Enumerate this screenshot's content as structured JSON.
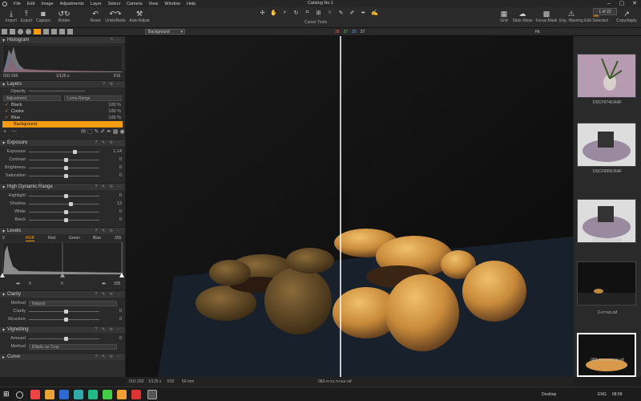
{
  "titlebar": {
    "menus": [
      "File",
      "Edit",
      "Image",
      "Adjustments",
      "Layer",
      "Select",
      "Camera",
      "View",
      "Window",
      "Help"
    ],
    "title": "Catalog No.1"
  },
  "toolbar": {
    "left": [
      "Import",
      "Export",
      "Capture",
      "Rotate",
      "Reset",
      "Undo/Redo",
      "Auto Adjust"
    ],
    "cursor_tools_label": "Cursor Tools",
    "right": [
      "Grid",
      "Slide Show",
      "Focus Mask",
      "Exp. Warning",
      "Edit Selected",
      "Copy/Apply"
    ],
    "page": "1 of 22"
  },
  "subbar": {
    "view": "Background",
    "numbers": [
      "38",
      "27",
      "25",
      "27"
    ],
    "fit": "Fit"
  },
  "histogram": {
    "title": "Histogram",
    "iso": "ISO 200",
    "shutter": "1/125 s",
    "aperture": "f/16"
  },
  "layers": {
    "title": "Layers",
    "opacity": "Opacity",
    "adjustment": "Adjustment",
    "luma": "Luma Range",
    "items": [
      {
        "name": "Black",
        "pct": "100 %"
      },
      {
        "name": "Cooks",
        "pct": "100 %"
      },
      {
        "name": "Blue",
        "pct": "100 %"
      },
      {
        "name": "Background",
        "pct": ""
      }
    ]
  },
  "exposure": {
    "title": "Exposure",
    "rows": [
      {
        "label": "Exposure",
        "value": "1.14",
        "pos": 0.62
      },
      {
        "label": "Contrast",
        "value": "0",
        "pos": 0.5
      },
      {
        "label": "Brightness",
        "value": "0",
        "pos": 0.5
      },
      {
        "label": "Saturation",
        "value": "0",
        "pos": 0.5
      }
    ]
  },
  "hdr": {
    "title": "High Dynamic Range",
    "rows": [
      {
        "label": "Highlight",
        "value": "0",
        "pos": 0.5
      },
      {
        "label": "Shadow",
        "value": "13",
        "pos": 0.57
      },
      {
        "label": "White",
        "value": "0",
        "pos": 0.5
      },
      {
        "label": "Black",
        "value": "0",
        "pos": 0.5
      }
    ]
  },
  "levels": {
    "title": "Levels",
    "left_val": "0",
    "right_val": "255",
    "channels": [
      "RGB",
      "Red",
      "Green",
      "Blue"
    ],
    "bottom_left": "0",
    "bottom_mid": "0",
    "bottom_right": "255"
  },
  "clarity": {
    "title": "Clarity",
    "method_label": "Method",
    "method": "Natural",
    "rows": [
      {
        "label": "Clarity",
        "value": "0",
        "pos": 0.5
      },
      {
        "label": "Structure",
        "value": "0",
        "pos": 0.5
      }
    ]
  },
  "vignetting": {
    "title": "Vignetting",
    "amount_label": "Amount",
    "amount": "0",
    "method_label": "Method",
    "method": "Elliptic on Crop"
  },
  "curve": {
    "title": "Curve"
  },
  "filmstrip": [
    {
      "label": "DSCF9740.RAF"
    },
    {
      "label": "DSCF9993.RAF"
    },
    {
      "label": "DSCF9994.RAF"
    },
    {
      "label": "2-מגירה.raf"
    },
    {
      "label": "083-עוגיות בבית.raf"
    }
  ],
  "status": {
    "iso": "ISO 200",
    "shutter": "1/125 s",
    "aperture": "f/16",
    "focal": "50 mm",
    "filename": "083-עוגיות בבית.raf"
  },
  "taskbar": {
    "desktop": "Desktop",
    "lang": "ENG",
    "time": "08:58"
  }
}
